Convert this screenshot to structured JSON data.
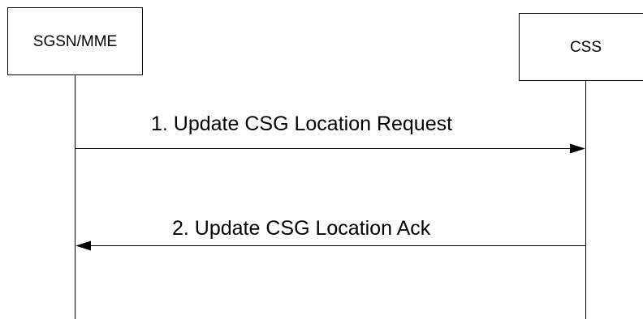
{
  "diagram": {
    "type": "sequence-diagram",
    "participants": [
      {
        "id": "sgsn_mme",
        "label": "SGSN/MME"
      },
      {
        "id": "css",
        "label": "CSS"
      }
    ],
    "messages": [
      {
        "from": "sgsn_mme",
        "to": "css",
        "label": "1. Update CSG Location Request"
      },
      {
        "from": "css",
        "to": "sgsn_mme",
        "label": "2. Update CSG Location Ack"
      }
    ]
  }
}
